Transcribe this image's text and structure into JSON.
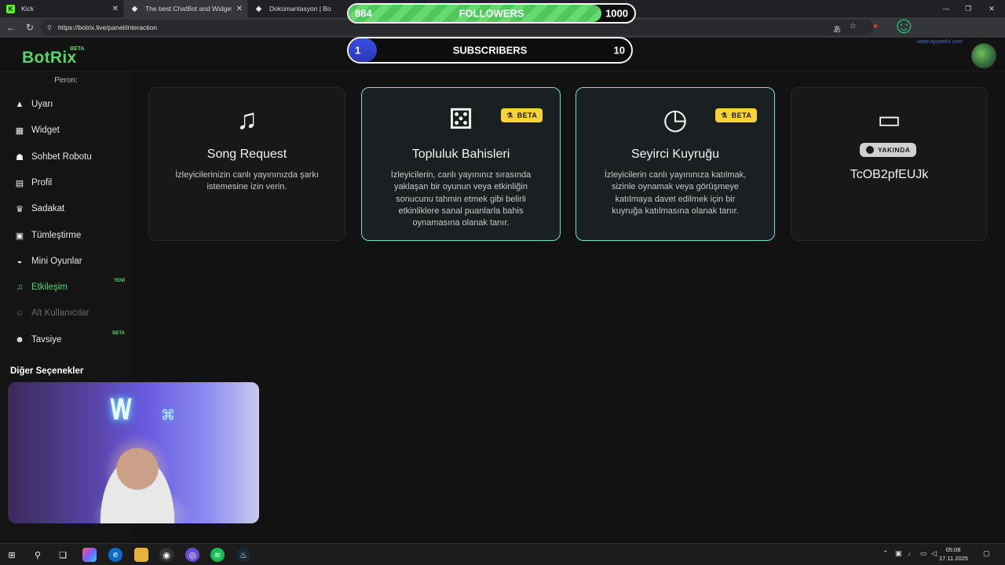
{
  "browser": {
    "tabs": [
      {
        "title": "Kick",
        "favicon": "kick-icon"
      },
      {
        "title": "The best ChatBot and Widgets fo",
        "favicon": "diamond-icon"
      },
      {
        "title": "Dokümantasyon | Bo",
        "favicon": "diamond-icon"
      }
    ],
    "url": "https://botrix.live/panel/interaction"
  },
  "overlay": {
    "followers": {
      "current": "884",
      "label": "FOLLOWERS",
      "goal": "1000",
      "progress": 0.884,
      "color": "#53d769"
    },
    "subscribers": {
      "current": "1",
      "label": "SUBSCRIBERS",
      "goal": "10",
      "progress": 0.1,
      "color": "#3447d6"
    },
    "watermark": "www.oyuneks.com"
  },
  "app": {
    "logo": "BotRix",
    "logo_badge": "BETA",
    "channel": "Peron:",
    "accent": "#53d769"
  },
  "sidebar": {
    "items": [
      {
        "label": "Uyarı",
        "icon": "warning-icon"
      },
      {
        "label": "Widget",
        "icon": "grid-icon"
      },
      {
        "label": "Sohbet Robotu",
        "icon": "robot-icon"
      },
      {
        "label": "Profil",
        "icon": "id-card-icon"
      },
      {
        "label": "Sadakat",
        "icon": "trophy-icon"
      },
      {
        "label": "Tümleştirme",
        "icon": "integration-icon"
      },
      {
        "label": "Mini Oyunlar",
        "icon": "gamepad-icon"
      },
      {
        "label": "Etkileşim",
        "icon": "music-icon",
        "tag": "YENİ",
        "active": true
      },
      {
        "label": "Alt Kullanıcılar",
        "icon": "users-icon",
        "disabled": true
      },
      {
        "label": "Tavsiye",
        "icon": "user-group-icon",
        "tag": "BETA"
      }
    ],
    "other_options": "Diğer Seçenekler"
  },
  "cards": [
    {
      "title": "Song Request",
      "icon": "music-icon",
      "description": "İzleyicilerinizin canlı yayınınızda şarkı istemesine izin verin."
    },
    {
      "title": "Topluluk Bahisleri",
      "icon": "dice-icon",
      "badge": "BETA",
      "description": "İzleyicilerin, canlı yayınınız sırasında yaklaşan bir oyunun veya etkinliğin sonucunu tahmin etmek gibi belirli etkinliklere sanal puanlarla bahis oynamasına olanak tanır."
    },
    {
      "title": "Seyirci Kuyruğu",
      "icon": "clock-icon",
      "badge": "BETA",
      "description": "İzleyicilerin canlı yayınınıza katılmak, sizinle oynamak veya görüşmeye katılmaya davet edilmek için bir kuyruğa katılmasına olanak tanır."
    },
    {
      "title": "TcOB2pfEUJk",
      "icon": "ticket-icon",
      "badge": "YAKINDA",
      "description": ""
    }
  ],
  "taskbar": {
    "time": "05:08",
    "date": "17.11.2025"
  }
}
